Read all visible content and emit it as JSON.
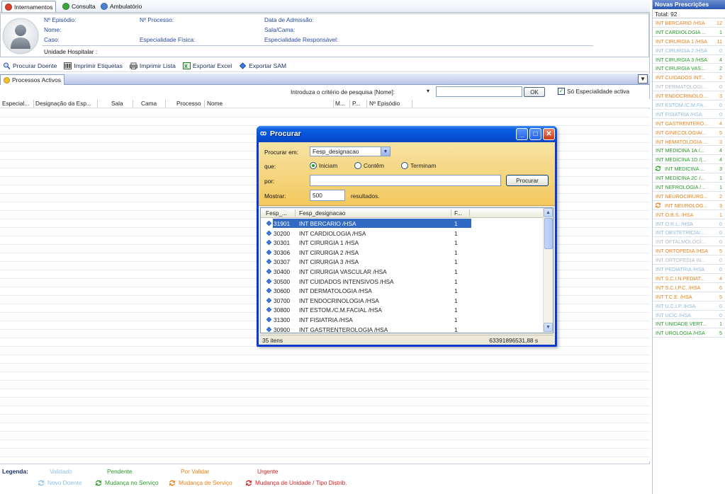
{
  "tabs": [
    {
      "label": "Internamentos",
      "color": "#d9402a",
      "active": true
    },
    {
      "label": "Consulta",
      "color": "#3aa63a",
      "active": false
    },
    {
      "label": "Ambulatório",
      "color": "#4a7fd1",
      "active": false
    }
  ],
  "patient": {
    "episodio": "Nº Episódio:",
    "nome": "Nome:",
    "caso": "Caso:",
    "processo": "Nº Processo:",
    "esp_fisica": "Especialidade Física:",
    "data_admissao": "Data de Admissão:",
    "sala_cama": "Sala/Cama:",
    "esp_responsavel": "Especialidade Responsável:",
    "unidade": "Unidade Hospitalar :"
  },
  "toolbar": {
    "procurar": "Procurar Doente",
    "etiquetas": "Imprimir Etiquetas",
    "lista": "Imprimir Lista",
    "excel": "Exportar Excel",
    "sam": "Exportar SAM"
  },
  "processes_tab": "Processos Activos",
  "search": {
    "criterion_label": "Introduza o critério de pesquisa [Nome]:",
    "ok": "OK",
    "active_only": "Só Especialidade activa"
  },
  "grid_columns": [
    "Especial...",
    "Designação da Esp...",
    "Sala",
    "Cama",
    "Processo",
    "Nome",
    "M...",
    "P...",
    "Nº Episódio"
  ],
  "legend": {
    "title": "Legenda:",
    "validado": "Validado",
    "novo_doente": "Novo Doente",
    "pendente": "Pendente",
    "mudanca_servico": "Mudança no Serviço",
    "por_validar": "Por Validar",
    "mudanca_servico2": "Mudança de Serviço",
    "urgente": "Urgente",
    "mudanca_unidade": "Mudança de Unidade / Tipo Distrib.",
    "colors": {
      "validado": "#8fc0e8",
      "pendente": "#2a9a2a",
      "por_validar": "#e8801a",
      "urgente": "#d42020"
    }
  },
  "right_panel": {
    "title": "Novas Prescrições",
    "total": "Total: 92",
    "items": [
      {
        "name": "INT BERCARIO /HSA",
        "count": "12",
        "color": "#e8801a",
        "icon": ""
      },
      {
        "name": "INT CARDIOLOGIA ...",
        "count": "1",
        "color": "#2a9a2a",
        "icon": ""
      },
      {
        "name": "INT CIRURGIA 1 /HSA",
        "count": "11",
        "color": "#e8801a",
        "icon": ""
      },
      {
        "name": "INT CIRURGIA 2 /HSA",
        "count": "0",
        "color": "#8fb8de",
        "icon": ""
      },
      {
        "name": "INT CIRURGIA 3 /HSA",
        "count": "4",
        "color": "#2a9a2a",
        "icon": ""
      },
      {
        "name": "INT CIRURGIA VAS...",
        "count": "2",
        "color": "#2a9a2a",
        "icon": ""
      },
      {
        "name": "INT CUIDADOS INT...",
        "count": "2",
        "color": "#e8801a",
        "icon": ""
      },
      {
        "name": "INT DERMATOLOGI...",
        "count": "0",
        "color": "#b0b8c4",
        "icon": ""
      },
      {
        "name": "INT ENDOCRINOLO...",
        "count": "3",
        "color": "#e8801a",
        "icon": ""
      },
      {
        "name": "INT ESTOM./C.M.FA...",
        "count": "0",
        "color": "#8fb8de",
        "icon": ""
      },
      {
        "name": "INT FISIATRIA /HSA",
        "count": "0",
        "color": "#8fb8de",
        "icon": ""
      },
      {
        "name": "INT GASTRENTERO...",
        "count": "4",
        "color": "#e8801a",
        "icon": ""
      },
      {
        "name": "INT GINECOLOGIA/...",
        "count": "5",
        "color": "#e8801a",
        "icon": ""
      },
      {
        "name": "INT HEMATOLOGIA ...",
        "count": "3",
        "color": "#e8801a",
        "icon": ""
      },
      {
        "name": "INT MEDICINA 1A /...",
        "count": "4",
        "color": "#2a9a2a",
        "icon": ""
      },
      {
        "name": "INT MEDICINA 1D /(...",
        "count": "4",
        "color": "#2a9a2a",
        "icon": ""
      },
      {
        "name": "INT MEDICINA ...",
        "count": "3",
        "color": "#2a9a2a",
        "icon": "green-arrows"
      },
      {
        "name": "INT MEDICINA 2C /...",
        "count": "1",
        "color": "#2a9a2a",
        "icon": ""
      },
      {
        "name": "INT NEFROLOGIA /...",
        "count": "1",
        "color": "#2a9a2a",
        "icon": ""
      },
      {
        "name": "INT NEUROCIRURG...",
        "count": "2",
        "color": "#e8801a",
        "icon": ""
      },
      {
        "name": "INT NEUROLOG...",
        "count": "3",
        "color": "#e8801a",
        "icon": "orange-arrows"
      },
      {
        "name": "INT O.B.S. /HSA",
        "count": "1",
        "color": "#e8801a",
        "icon": ""
      },
      {
        "name": "INT O.R.L. /HSA",
        "count": "0",
        "color": "#8fb8de",
        "icon": ""
      },
      {
        "name": "INT OBSTETRICIA/...",
        "count": "0",
        "color": "#8fb8de",
        "icon": ""
      },
      {
        "name": "INT OFTALMOLOGI...",
        "count": "0",
        "color": "#b0b8c4",
        "icon": ""
      },
      {
        "name": "INT ORTOPEDIA /HSA",
        "count": "5",
        "color": "#e8801a",
        "icon": ""
      },
      {
        "name": "INT ORTOPEDIA IN...",
        "count": "0",
        "color": "#b0b8c4",
        "icon": ""
      },
      {
        "name": "INT PEDIATRIA /HSA",
        "count": "0",
        "color": "#8fb8de",
        "icon": ""
      },
      {
        "name": "INT S.C.I.N.PEDIAT...",
        "count": "4",
        "color": "#e8801a",
        "icon": ""
      },
      {
        "name": "INT S.C.I.P.C. /HSA",
        "count": "6",
        "color": "#e8801a",
        "icon": ""
      },
      {
        "name": "INT T.C.E. /HSA",
        "count": "5",
        "color": "#e8801a",
        "icon": ""
      },
      {
        "name": "INT U.C.I.P. /HSA",
        "count": "0",
        "color": "#8fb8de",
        "icon": ""
      },
      {
        "name": "INT UCIC /HSA",
        "count": "0",
        "color": "#8fb8de",
        "icon": ""
      },
      {
        "name": "INT UNIDADE VERT...",
        "count": "1",
        "color": "#2a9a2a",
        "icon": ""
      },
      {
        "name": "INT UROLOGIA /HSA",
        "count": "5",
        "color": "#2a9a2a",
        "icon": ""
      }
    ]
  },
  "dialog": {
    "title": "Procurar",
    "procurar_em_label": "Procurar em:",
    "procurar_em_value": "Fesp_designacao",
    "que_label": "que:",
    "radio_iniciam": "Iniciam",
    "radio_contem": "Contêm",
    "radio_terminam": "Terminam",
    "selected_radio": "iniciam",
    "por_label": "por:",
    "por_value": "",
    "procurar_btn": "Procurar",
    "mostrar_label": "Mostrar:",
    "mostrar_value": "500",
    "resultados": "resultados.",
    "columns": [
      "Fesp_...",
      "Fesp_designacao",
      "F..."
    ],
    "rows": [
      {
        "code": "31901",
        "name": "INT BERCARIO /HSA",
        "f": "1",
        "selected": true
      },
      {
        "code": "30200",
        "name": "INT CARDIOLOGIA /HSA",
        "f": "1",
        "selected": false
      },
      {
        "code": "30301",
        "name": "INT CIRURGIA 1 /HSA",
        "f": "1",
        "selected": false
      },
      {
        "code": "30306",
        "name": "INT CIRURGIA 2 /HSA",
        "f": "1",
        "selected": false
      },
      {
        "code": "30307",
        "name": "INT CIRURGIA 3 /HSA",
        "f": "1",
        "selected": false
      },
      {
        "code": "30400",
        "name": "INT CIRURGIA VASCULAR /HSA",
        "f": "1",
        "selected": false
      },
      {
        "code": "30500",
        "name": "INT CUIDADOS INTENSIVOS /HSA",
        "f": "1",
        "selected": false
      },
      {
        "code": "30600",
        "name": "INT DERMATOLOGIA /HSA",
        "f": "1",
        "selected": false
      },
      {
        "code": "30700",
        "name": "INT ENDOCRINOLOGIA /HSA",
        "f": "1",
        "selected": false
      },
      {
        "code": "30800",
        "name": "INT ESTOM./C.M.FACIAL /HSA",
        "f": "1",
        "selected": false
      },
      {
        "code": "31300",
        "name": "INT FISIATRIA /HSA",
        "f": "1",
        "selected": false
      },
      {
        "code": "30900",
        "name": "INT GASTRENTEROLOGIA /HSA",
        "f": "1",
        "selected": false
      }
    ],
    "status_count": "35 itens",
    "status_time": "63391896531,88 s"
  }
}
